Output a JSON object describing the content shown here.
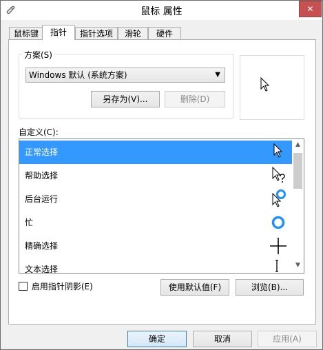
{
  "window": {
    "title": "鼠标 属性",
    "close_glyph": "✕"
  },
  "tabs": [
    {
      "label": "鼠标键",
      "active": false
    },
    {
      "label": "指针",
      "active": true
    },
    {
      "label": "指针选项",
      "active": false
    },
    {
      "label": "滑轮",
      "active": false
    },
    {
      "label": "硬件",
      "active": false
    }
  ],
  "scheme": {
    "group_label": "方案(S)",
    "selected": "Windows 默认 (系统方案)",
    "save_as_label": "另存为(V)...",
    "delete_label": "删除(D)"
  },
  "preview": {
    "cursor": "arrow-cursor-icon"
  },
  "customize": {
    "label": "自定义(C):",
    "items": [
      {
        "label": "正常选择",
        "cursor": "arrow-cursor-icon",
        "selected": true
      },
      {
        "label": "帮助选择",
        "cursor": "help-cursor-icon",
        "selected": false
      },
      {
        "label": "后台运行",
        "cursor": "working-in-background-cursor-icon",
        "selected": false
      },
      {
        "label": "忙",
        "cursor": "busy-cursor-icon",
        "selected": false
      },
      {
        "label": "精确选择",
        "cursor": "crosshair-cursor-icon",
        "selected": false
      },
      {
        "label": "文本选择",
        "cursor": "text-cursor-icon",
        "selected": false
      }
    ]
  },
  "options": {
    "shadow_label": "启用指针阴影(E)",
    "shadow_checked": false,
    "use_default_label": "使用默认值(F)",
    "browse_label": "浏览(B)..."
  },
  "footer": {
    "ok_label": "确定",
    "cancel_label": "取消",
    "apply_label": "应用(A)"
  },
  "colors": {
    "selection": "#3399ff",
    "busy_ring": "#1e90ff",
    "close_button": "#c75050"
  }
}
